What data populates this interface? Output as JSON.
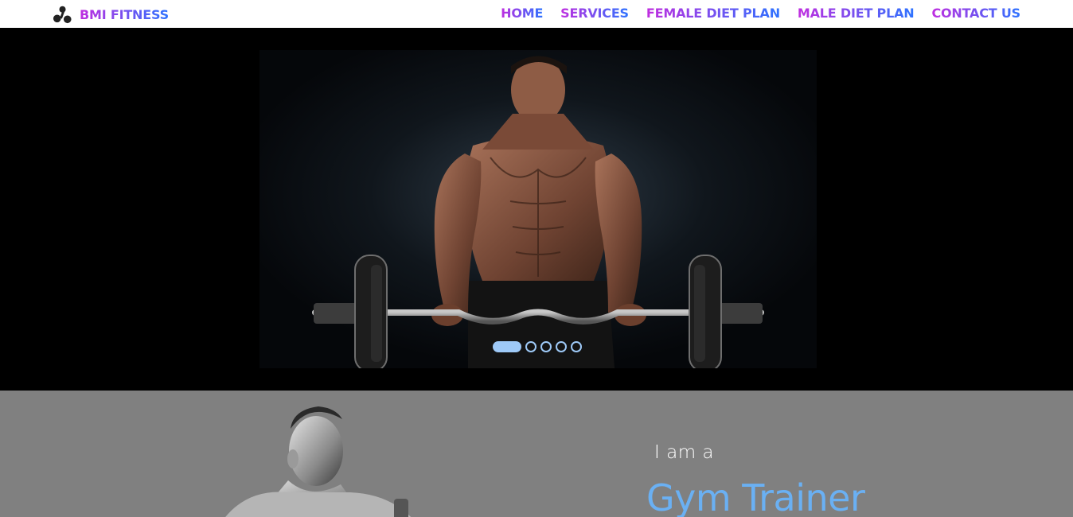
{
  "brand": {
    "name": "BMI FITNESS",
    "icon": "dumbbell-plates-icon"
  },
  "nav": {
    "items": [
      {
        "label": "HOME"
      },
      {
        "label": "SERVICES"
      },
      {
        "label": "FEMALE DIET PLAN"
      },
      {
        "label": "MALE DIET PLAN"
      },
      {
        "label": "CONTACT US"
      }
    ]
  },
  "colors": {
    "nav_gradient_start": "#c02ee0",
    "nav_gradient_end": "#2e73ff",
    "hero_bg": "#000000",
    "about_bg": "#808080",
    "accent_blue": "#6ab0f3",
    "dot_color": "#9ec9f7"
  },
  "hero": {
    "image": "bodybuilder-lifting-barbell-photo",
    "slides_total": 5,
    "active_slide": 1
  },
  "about": {
    "image": "gym-trainer-photo",
    "intro": "I am a",
    "role": "Gym Trainer"
  }
}
